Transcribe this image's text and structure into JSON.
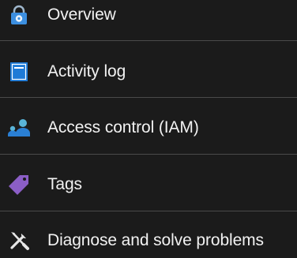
{
  "nav": {
    "items": [
      {
        "label": "Overview",
        "icon": "overview-lock-icon"
      },
      {
        "label": "Activity log",
        "icon": "activity-log-icon"
      },
      {
        "label": "Access control (IAM)",
        "icon": "access-control-users-icon"
      },
      {
        "label": "Tags",
        "icon": "tag-icon"
      },
      {
        "label": "Diagnose and solve problems",
        "icon": "wrench-screwdriver-icon"
      }
    ]
  },
  "colors": {
    "background": "#1b1b1b",
    "text": "#f2f2f2",
    "divider": "#4a4a4a",
    "icon_blue": "#2a7fd4",
    "icon_light_blue": "#59b4d9",
    "tag_purple": "#8b5ec6"
  }
}
